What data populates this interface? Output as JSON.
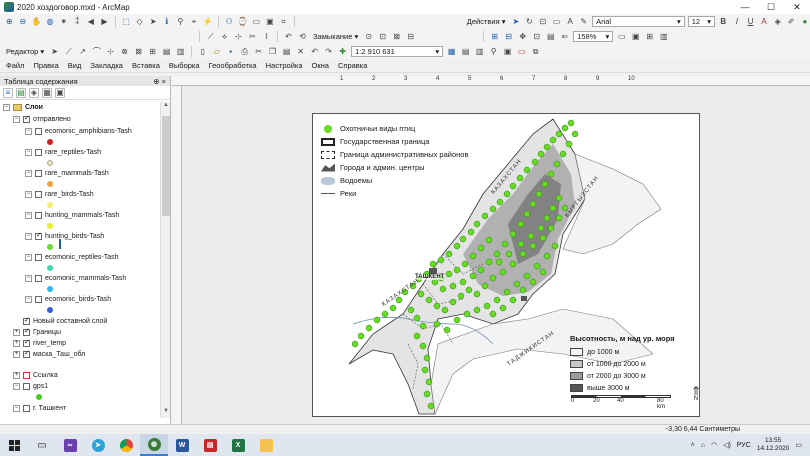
{
  "window": {
    "title": "2020 хоздоговор.mxd - ArcMap",
    "minimize": "—",
    "maximize": "☐",
    "close": "✕"
  },
  "toolbar1": {
    "actions_label": "Действия ▾",
    "font_name": "Arial",
    "font_size": "12"
  },
  "toolbar2": {
    "replace_label": "Замыкание ▾",
    "zoom_value": "158%"
  },
  "toolbar3": {
    "editor_label": "Редактор ▾",
    "scale_value": "1:2 910 631"
  },
  "menu": [
    "Файл",
    "Правка",
    "Вид",
    "Закладка",
    "Вставка",
    "Выборка",
    "Геообработка",
    "Настройка",
    "Окна",
    "Справка"
  ],
  "toc": {
    "title": "Таблица содержания",
    "pin": "⊕ ×",
    "layers_root": "Слои",
    "group": "отправлено",
    "items": [
      {
        "label": "ecomonic_amphibians-Tash",
        "checked": false,
        "color": "#d02020"
      },
      {
        "label": "rare_reptiles-Tash",
        "checked": false,
        "color": "#e8e2b0"
      },
      {
        "label": "rare_mammals-Tash",
        "checked": false,
        "color": "#f0a040"
      },
      {
        "label": "rare_birds-Tash",
        "checked": false,
        "color": "#f2f06a"
      },
      {
        "label": "hunting_mammals-Tash",
        "checked": false,
        "color": "#e6f030"
      },
      {
        "label": "hunting_birds-Tash",
        "checked": true,
        "color": "#66dd33"
      },
      {
        "label": "ecomonic_reptiles-Tash",
        "checked": false,
        "color": "#40d8b0"
      },
      {
        "label": "ecomonic_mammals-Tash",
        "checked": false,
        "color": "#30b8f0"
      },
      {
        "label": "ecomonic_birds-Tash",
        "checked": false,
        "color": "#3060d0"
      }
    ],
    "others": [
      {
        "label": "Новый составной слой",
        "checked": true
      },
      {
        "label": "Границы",
        "checked": true
      },
      {
        "label": "river_temp",
        "checked": true
      },
      {
        "label": "маска_Таш_обл",
        "checked": true
      },
      {
        "label": "Ссылка",
        "checked": false
      },
      {
        "label": "gps1",
        "checked": false
      },
      {
        "label": "г. Ташкент",
        "checked": false
      }
    ]
  },
  "ruler_ticks": [
    "1",
    "2",
    "3",
    "4",
    "5",
    "6",
    "7",
    "8",
    "9",
    "10"
  ],
  "legend": {
    "items": [
      "Охотничьи виды птиц",
      "Государственная граница",
      "Граница административных районов",
      "Города и админ. центры",
      "Водоемы",
      "Реки"
    ],
    "colors": {
      "birds": "#66dd22",
      "water": "#b8c8d8"
    }
  },
  "map_labels": {
    "city": "ТАШКЕНТ",
    "kz1": "КАЗАХСТАН",
    "kg": "КЫРГЫЗСТАН",
    "kz2": "КАЗАХСТАН",
    "tj": "ТАДЖИКИСТАН"
  },
  "elevation": {
    "title": "Высотность, м над ур. моря",
    "classes": [
      {
        "label": "до 1000 м",
        "color": "#f5f5f5"
      },
      {
        "label": "от 1000 до 2000 м",
        "color": "#c8c8c8"
      },
      {
        "label": "от 2000 до 3000 м",
        "color": "#9a9a9a"
      },
      {
        "label": "выше 3000 м",
        "color": "#555555"
      }
    ]
  },
  "scale": {
    "ticks": [
      "0",
      "20",
      "40",
      "80 km"
    ]
  },
  "north": "N",
  "status": {
    "coords": "-3,30  6,44 Сантиметры"
  },
  "taskbar": {
    "lang": "РУС",
    "time": "13:55",
    "date": "14.12.2020"
  }
}
